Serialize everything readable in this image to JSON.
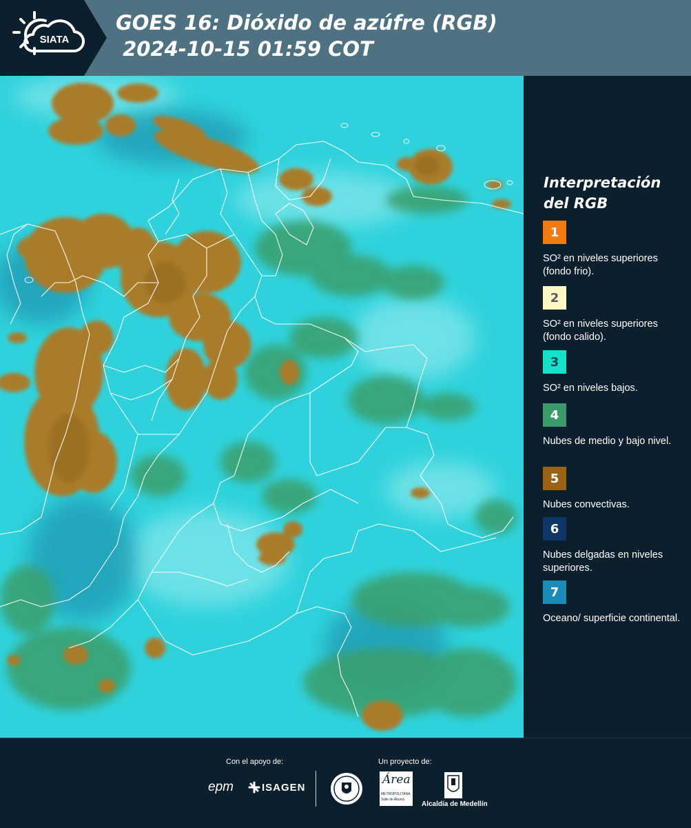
{
  "header": {
    "logo_text": "SIATA",
    "title": "GOES 16: Dióxido de azúfre (RGB)\n 2024-10-15 01:59 COT"
  },
  "legend": {
    "title": "Interpretación del RGB",
    "items": [
      {
        "number": "1",
        "label": "SO² en niveles superiores (fondo frio).",
        "color": "#f27a0e"
      },
      {
        "number": "2",
        "label": "SO² en niveles superiores (fondo calido).",
        "color": "#fff8c4"
      },
      {
        "number": "3",
        "label": "SO² en niveles bajos.",
        "color": "#14e3cc"
      },
      {
        "number": "4",
        "label": "Nubes de medio y bajo nivel.",
        "color": "#3a9a6a"
      },
      {
        "number": "5",
        "label": "Nubes convectivas.",
        "color": "#9a6214"
      },
      {
        "number": "6",
        "label": "Nubes delgadas en niveles superiores.",
        "color": "#0f3668"
      },
      {
        "number": "7",
        "label": "Oceano/ superficie continental.",
        "color": "#1a8cba"
      }
    ]
  },
  "footer": {
    "support_label": "Con el apoyo de:",
    "support_logos": [
      "epm",
      "ISAGEN"
    ],
    "project_label": "Un proyecto de:",
    "area_logo_text": "Área",
    "area_logo_subtext": "METROPOLITANA",
    "area_logo_subtext2": "Valle de Aburrá",
    "alcaldia_text": "Alcaldía de Medellín"
  },
  "colors": {
    "header_bg": "#4e7282",
    "panel_bg": "#0c1f2d",
    "map_base": "#2fd2dc",
    "convective": "#a97c2c",
    "low_clouds": "#38a66e"
  }
}
